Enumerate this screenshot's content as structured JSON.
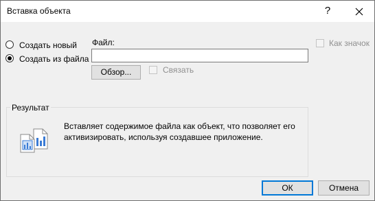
{
  "dialog": {
    "title": "Вставка объекта",
    "help_glyph": "?",
    "close_icon": "close-icon"
  },
  "options": {
    "create_new": {
      "label": "Создать новый",
      "checked": false
    },
    "create_from_file": {
      "label": "Создать из файла",
      "checked": true
    }
  },
  "file": {
    "label": "Файл:",
    "value": "",
    "browse_label": "Обзор...",
    "link_label": "Связать",
    "link_checked": false
  },
  "display_as_icon": {
    "label": "Как значок",
    "checked": false
  },
  "result": {
    "title": "Результат",
    "text": "Вставляет содержимое файла как объект, что позволяет его активизировать, используя создавшее приложение.",
    "icon": "document-chart-icon"
  },
  "buttons": {
    "ok": "ОК",
    "cancel": "Отмена"
  },
  "colors": {
    "accent": "#0078d7",
    "icon_blue": "#3a7bd5"
  }
}
